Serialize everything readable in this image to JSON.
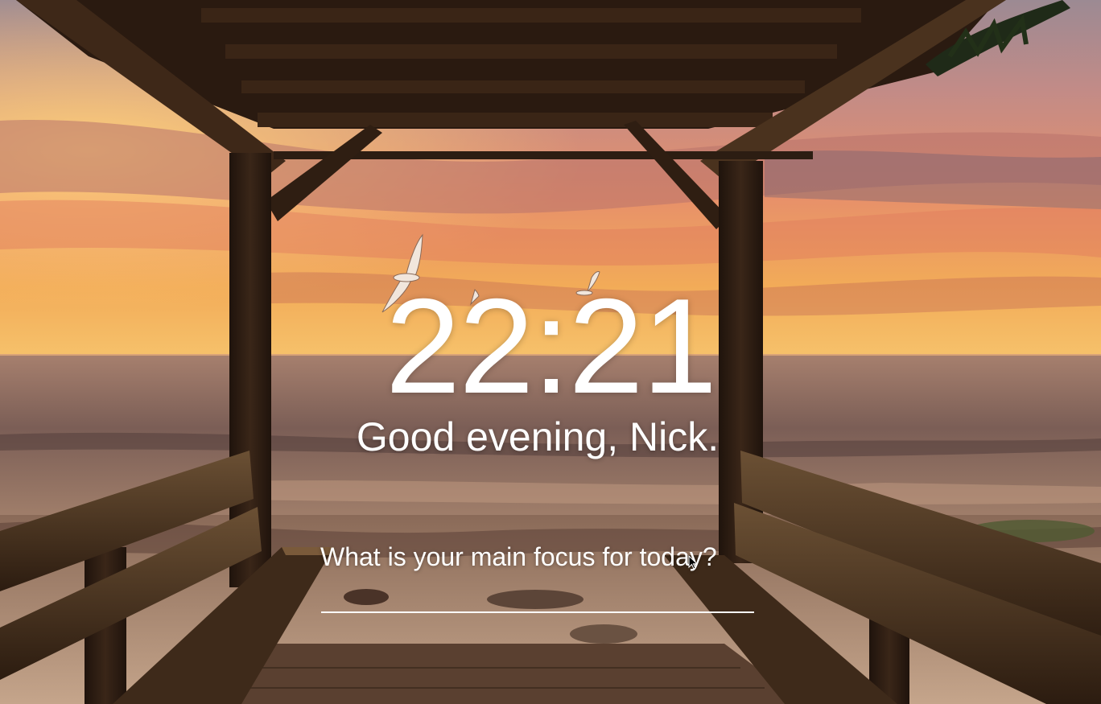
{
  "clock": {
    "time": "22:21"
  },
  "greeting": {
    "text": "Good evening, Nick."
  },
  "focus": {
    "question": "What is your main focus for today?",
    "input_value": "",
    "input_placeholder": ""
  },
  "background": {
    "scene": "sunset-beach-gazebo",
    "colors": {
      "sky_top": "#b88a8a",
      "sky_glow": "#f4a64a",
      "cloud_pink": "#e58a6a",
      "sea": "#6e5550",
      "wood": "#2b1a10"
    }
  },
  "icons": {
    "mouse_cursor": "arrow-cursor"
  }
}
